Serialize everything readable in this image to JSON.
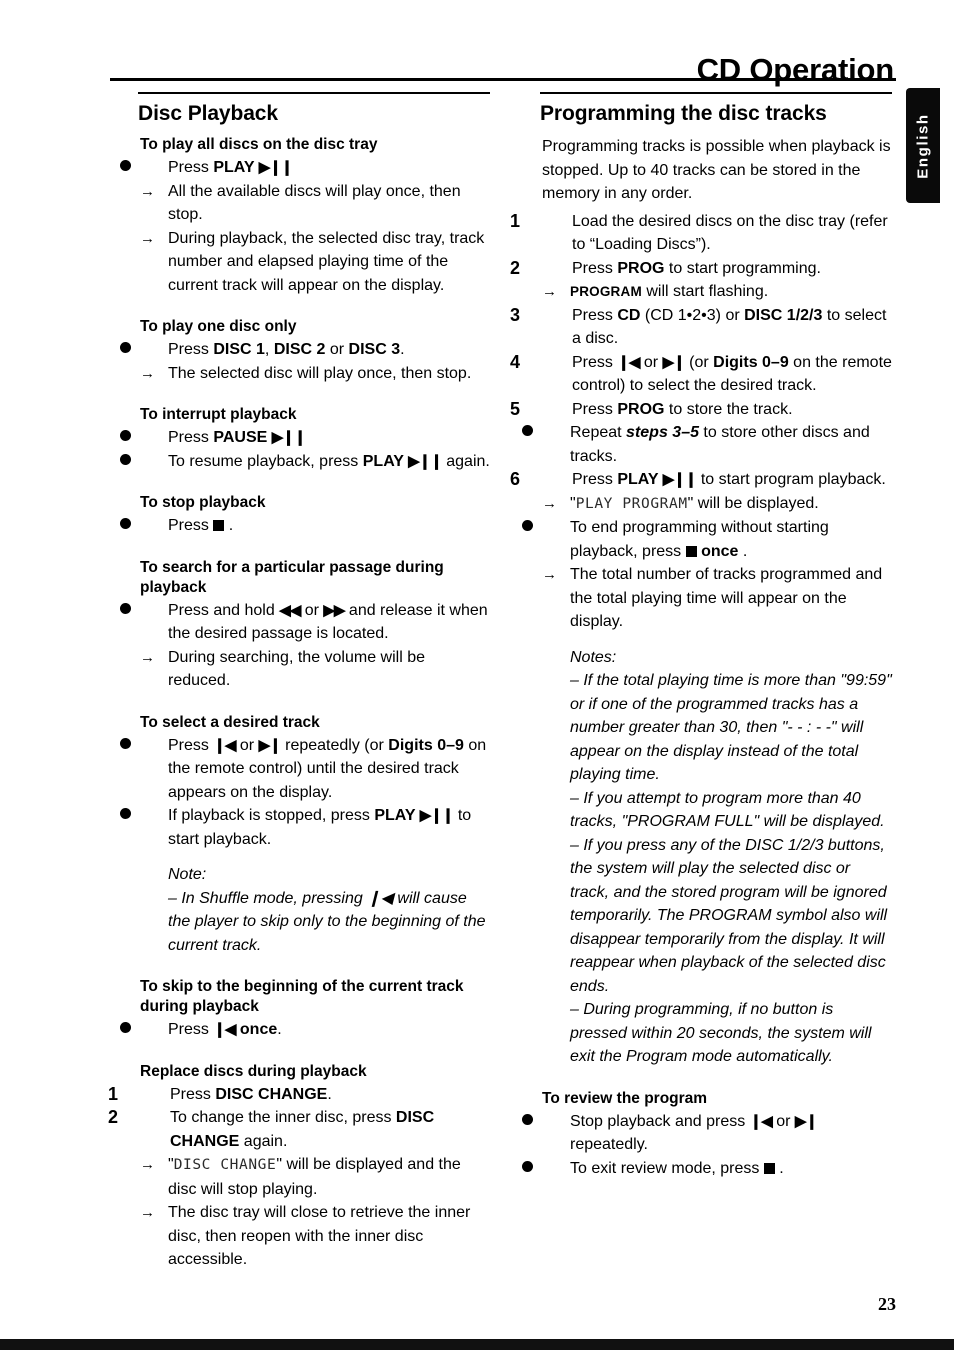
{
  "page": {
    "title": "CD Operation",
    "number": "23",
    "language_tab": "English"
  },
  "left_column": {
    "heading": "Disc Playback",
    "blocks": [
      {
        "sub_head": "To play all discs on the disc tray",
        "items": [
          {
            "marker": "bullet",
            "text_parts": [
              {
                "t": "Press "
              },
              {
                "t": "PLAY ",
                "b": true
              },
              {
                "t": "▶❙❙",
                "glyph": true
              }
            ]
          },
          {
            "marker": "arrow",
            "text_parts": [
              {
                "t": "All the available discs will play once, then stop."
              }
            ]
          },
          {
            "marker": "arrow",
            "text_parts": [
              {
                "t": "During playback, the selected disc tray, track number and elapsed playing time of the current track will appear on the display."
              }
            ]
          }
        ]
      },
      {
        "sub_head": "To play one disc only",
        "items": [
          {
            "marker": "bullet",
            "text_parts": [
              {
                "t": "Press "
              },
              {
                "t": "DISC 1",
                "b": true
              },
              {
                "t": ", "
              },
              {
                "t": "DISC 2",
                "b": true
              },
              {
                "t": " or "
              },
              {
                "t": "DISC 3",
                "b": true
              },
              {
                "t": "."
              }
            ]
          },
          {
            "marker": "arrow",
            "text_parts": [
              {
                "t": "The selected disc will play once, then stop."
              }
            ]
          }
        ]
      },
      {
        "sub_head": "To interrupt playback",
        "items": [
          {
            "marker": "bullet",
            "text_parts": [
              {
                "t": "Press "
              },
              {
                "t": "PAUSE ",
                "b": true
              },
              {
                "t": "▶❙❙",
                "glyph": true
              }
            ]
          },
          {
            "marker": "bullet",
            "text_parts": [
              {
                "t": "To resume playback, press "
              },
              {
                "t": "PLAY ",
                "b": true
              },
              {
                "t": "▶❙❙",
                "glyph": true
              },
              {
                "t": " again."
              }
            ]
          }
        ]
      },
      {
        "sub_head": "To stop playback",
        "items": [
          {
            "marker": "bullet",
            "text_parts": [
              {
                "t": "Press "
              },
              {
                "t": "STOP",
                "stop": true
              },
              {
                "t": " ."
              }
            ]
          }
        ]
      },
      {
        "sub_head": "To search for a particular passage during playback",
        "items": [
          {
            "marker": "bullet",
            "text_parts": [
              {
                "t": "Press and hold "
              },
              {
                "t": "◀◀",
                "glyph": true
              },
              {
                "t": " or "
              },
              {
                "t": "▶▶",
                "glyph": true
              },
              {
                "t": " and release it when the desired passage is located."
              }
            ]
          },
          {
            "marker": "arrow",
            "text_parts": [
              {
                "t": "During searching, the volume will be reduced."
              }
            ]
          }
        ]
      },
      {
        "sub_head": "To select a desired track",
        "items": [
          {
            "marker": "bullet",
            "text_parts": [
              {
                "t": "Press "
              },
              {
                "t": "❙◀",
                "glyph": true
              },
              {
                "t": " or "
              },
              {
                "t": "▶❙",
                "glyph": true
              },
              {
                "t": " repeatedly (or "
              },
              {
                "t": "Digits 0–9",
                "b": true
              },
              {
                "t": " on the remote control) until the desired track appears on the display."
              }
            ]
          },
          {
            "marker": "bullet",
            "text_parts": [
              {
                "t": "If playback is stopped, press "
              },
              {
                "t": "PLAY ",
                "b": true
              },
              {
                "t": "▶❙❙",
                "glyph": true
              },
              {
                "t": " to start playback."
              }
            ]
          }
        ],
        "note_title": "Note:",
        "notes": [
          "–  In Shuffle mode, pressing ❙◀ will cause the player to skip only to the beginning of the current track."
        ]
      },
      {
        "sub_head": "To skip to the beginning of the current track during playback",
        "items": [
          {
            "marker": "bullet",
            "text_parts": [
              {
                "t": "Press "
              },
              {
                "t": "❙◀",
                "glyph": true
              },
              {
                "t": " "
              },
              {
                "t": "once",
                "b": true
              },
              {
                "t": "."
              }
            ]
          }
        ]
      },
      {
        "sub_head": "Replace discs during playback",
        "items": [
          {
            "marker": "1",
            "text_parts": [
              {
                "t": "Press "
              },
              {
                "t": "DISC CHANGE",
                "b": true
              },
              {
                "t": "."
              }
            ]
          },
          {
            "marker": "2",
            "text_parts": [
              {
                "t": "To change the inner disc, press "
              },
              {
                "t": "DISC CHANGE",
                "b": true
              },
              {
                "t": " again."
              }
            ]
          },
          {
            "marker": "arrow",
            "text_parts": [
              {
                "t": "\""
              },
              {
                "t": "DISC CHANGE",
                "lcd": true
              },
              {
                "t": "\" will be displayed and the disc will stop playing."
              }
            ]
          },
          {
            "marker": "arrow",
            "text_parts": [
              {
                "t": "The disc tray will close to retrieve the inner disc, then reopen with the inner disc accessible."
              }
            ]
          }
        ]
      }
    ]
  },
  "right_column": {
    "heading": "Programming the disc tracks",
    "intro": "Programming tracks is possible when playback is stopped. Up to 40 tracks can be stored in the memory in any order.",
    "blocks": [
      {
        "items": [
          {
            "marker": "1",
            "text_parts": [
              {
                "t": "Load the desired discs on the disc tray (refer to “Loading Discs”)."
              }
            ]
          },
          {
            "marker": "2",
            "text_parts": [
              {
                "t": "Press "
              },
              {
                "t": "PROG",
                "b": true
              },
              {
                "t": " to start programming."
              }
            ]
          },
          {
            "marker": "arrow",
            "text_parts": [
              {
                "t": "PROGRAM",
                "sc": true
              },
              {
                "t": " will start flashing."
              }
            ]
          },
          {
            "marker": "3",
            "text_parts": [
              {
                "t": "Press "
              },
              {
                "t": "CD",
                "b": true
              },
              {
                "t": " (CD 1•2•3) or "
              },
              {
                "t": "DISC 1/2/3",
                "b": true
              },
              {
                "t": " to select a disc."
              }
            ]
          },
          {
            "marker": "4",
            "text_parts": [
              {
                "t": "Press "
              },
              {
                "t": "❙◀",
                "glyph": true
              },
              {
                "t": " or "
              },
              {
                "t": "▶❙",
                "glyph": true
              },
              {
                "t": " (or "
              },
              {
                "t": "Digits 0–9",
                "b": true
              },
              {
                "t": " on the remote control) to select the desired track."
              }
            ]
          },
          {
            "marker": "5",
            "text_parts": [
              {
                "t": "Press "
              },
              {
                "t": "PROG",
                "b": true
              },
              {
                "t": " to store the track."
              }
            ]
          },
          {
            "marker": "bullet",
            "text_parts": [
              {
                "t": "Repeat "
              },
              {
                "t": "steps 3–5",
                "bi": true
              },
              {
                "t": " to store other discs and tracks."
              }
            ]
          },
          {
            "marker": "6",
            "text_parts": [
              {
                "t": "Press "
              },
              {
                "t": "PLAY ",
                "b": true
              },
              {
                "t": "▶❙❙",
                "glyph": true
              },
              {
                "t": " to start program playback."
              }
            ]
          },
          {
            "marker": "arrow",
            "text_parts": [
              {
                "t": "\""
              },
              {
                "t": "PLAY PROGRAM",
                "lcd": true
              },
              {
                "t": "\" will be displayed."
              }
            ]
          },
          {
            "marker": "bullet",
            "text_parts": [
              {
                "t": "To end programming without starting playback, press "
              },
              {
                "t": "STOP",
                "stop": true
              },
              {
                "t": " "
              },
              {
                "t": "once",
                "b": true
              },
              {
                "t": " ."
              }
            ]
          },
          {
            "marker": "arrow",
            "text_parts": [
              {
                "t": "The total number of tracks programmed and the total playing time will appear on the display."
              }
            ]
          }
        ],
        "note_title": "Notes:",
        "notes": [
          "–  If the total playing time is more than \"99:59\" or if one of the programmed tracks has a number greater than 30, then \"- - : - -\" will appear on the display instead of the total playing time.",
          "–  If you attempt to program more than 40 tracks, \"PROGRAM FULL\" will be displayed.",
          "–  If you press any of the DISC 1/2/3 buttons, the system will play the selected disc or track, and the stored program will be ignored temporarily. The PROGRAM symbol also will disappear temporarily from the display. It will reappear when playback of the selected disc ends.",
          "–  During programming, if no button is pressed within 20 seconds, the system will exit the Program mode automatically."
        ]
      },
      {
        "sub_head": "To review the program",
        "items": [
          {
            "marker": "bullet",
            "text_parts": [
              {
                "t": "Stop playback and press "
              },
              {
                "t": "❙◀",
                "glyph": true
              },
              {
                "t": " or "
              },
              {
                "t": "▶❙",
                "glyph": true
              },
              {
                "t": " repeatedly."
              }
            ]
          },
          {
            "marker": "bullet",
            "text_parts": [
              {
                "t": "To exit review mode, press "
              },
              {
                "t": "STOP",
                "stop": true
              },
              {
                "t": " ."
              }
            ]
          }
        ]
      }
    ]
  }
}
